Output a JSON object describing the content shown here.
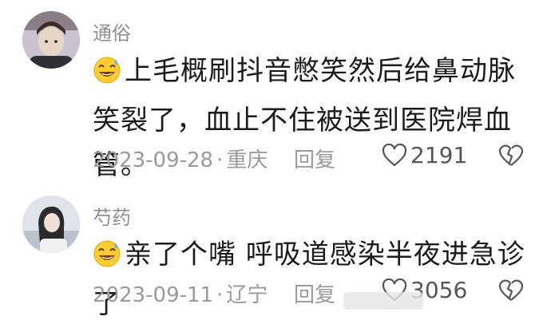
{
  "comments": [
    {
      "username": "通俗",
      "avatar_icon": "avatar-man-icon",
      "emoji_icon": "sweat-smile-emoji",
      "content": "上毛概刷抖音憋笑然后给鼻动脉笑裂了，血止不住被送到医院焊血管。",
      "date": "2023-09-28",
      "separator": "·",
      "location": "重庆",
      "reply_label": "回复",
      "like_count": "2191"
    },
    {
      "username": "芍药",
      "avatar_icon": "avatar-woman-icon",
      "emoji_icon": "sweat-smile-emoji",
      "content": "亲了个嘴 呼吸道感染半夜进急诊了",
      "date": "2023-09-11",
      "separator": "·",
      "location": "辽宁",
      "reply_label": "回复",
      "like_count": "3056"
    }
  ],
  "colors": {
    "text_primary": "#1b1b1b",
    "text_secondary": "#9a9a9a",
    "emoji_yellow": "#ffcc33"
  }
}
